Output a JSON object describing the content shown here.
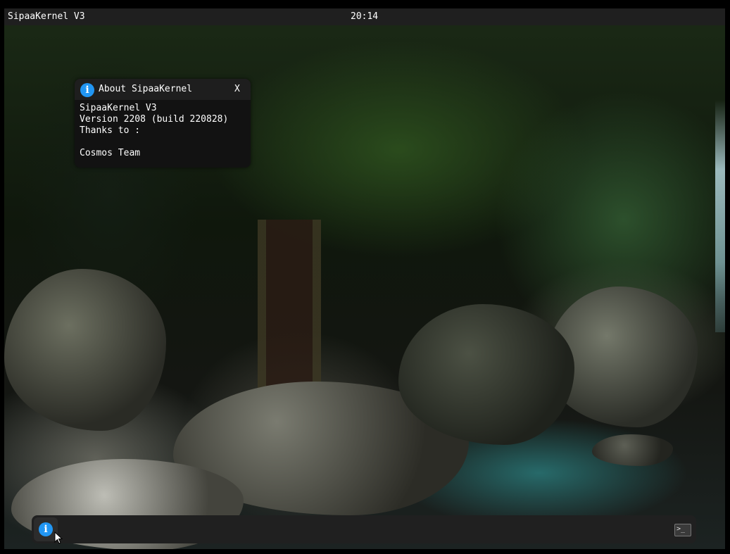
{
  "topbar": {
    "title": "SipaaKernel V3",
    "clock": "20:14"
  },
  "about_window": {
    "icon": "info-icon",
    "title": "About SipaaKernel",
    "close_label": "X",
    "lines": [
      "SipaaKernel V3",
      "Version 2208 (build 220828)",
      "Thanks to :",
      "",
      "Cosmos Team"
    ]
  },
  "taskbar": {
    "app_icon": "info-icon",
    "app_icon_glyph": "i",
    "terminal_icon": "terminal-icon",
    "terminal_glyph": ">_"
  },
  "colors": {
    "bar_bg": "#1f1f1f",
    "window_bg": "#121212",
    "accent": "#2196f3",
    "text": "#ffffff"
  }
}
